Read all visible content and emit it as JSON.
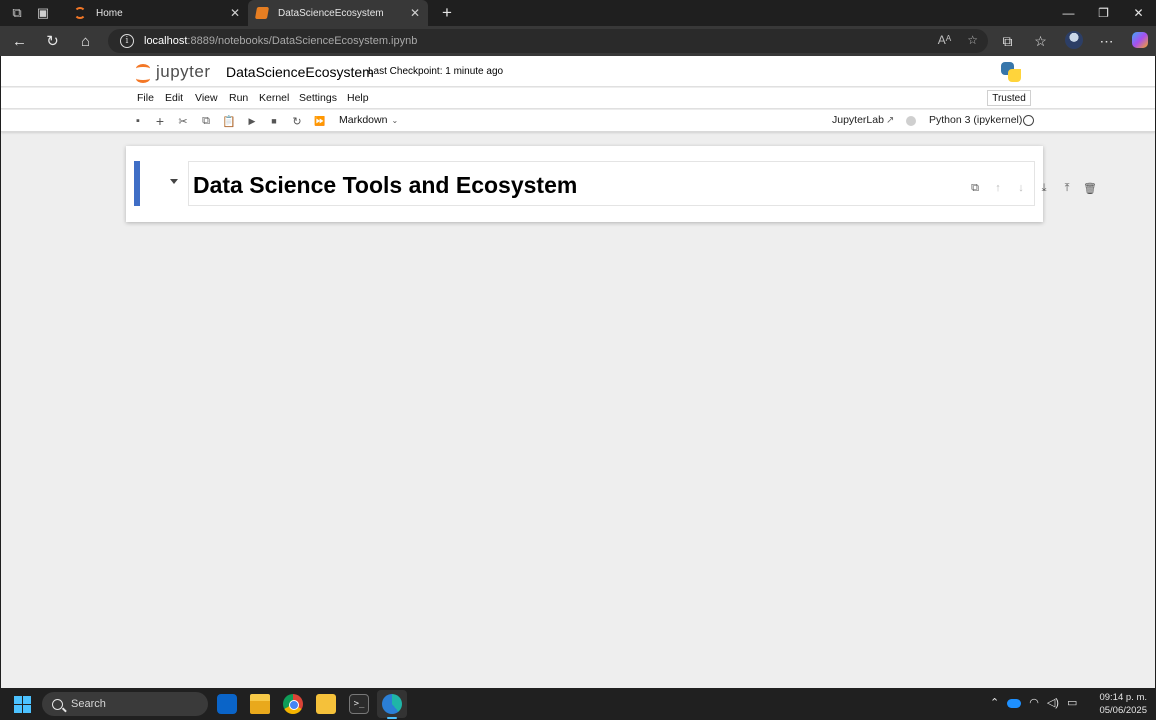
{
  "browser": {
    "tabs": [
      {
        "title": "Home",
        "close": "✕"
      },
      {
        "title": "DataScienceEcosystem",
        "close": "✕"
      }
    ],
    "new_tab": "+",
    "url_host": "localhost",
    "url_path": ":8889/notebooks/DataScienceEcosystem.ipynb",
    "window_controls": [
      "—",
      "❐",
      "✕"
    ]
  },
  "jupyter": {
    "logo_text": "jupyter",
    "notebook_title": "DataScienceEcosystem",
    "checkpoint": "Last Checkpoint: 1 minute ago",
    "menu": [
      "File",
      "Edit",
      "View",
      "Run",
      "Kernel",
      "Settings",
      "Help"
    ],
    "trusted": "Trusted",
    "cell_type": "Markdown",
    "jupyterlab_link": "JupyterLab",
    "kernel_name": "Python 3 (ipykernel)"
  },
  "notebook": {
    "cells": [
      {
        "type": "markdown",
        "rendered_heading": "Data Science Tools and Ecosystem"
      }
    ]
  },
  "taskbar": {
    "search_placeholder": "Search",
    "time": "09:14 p. m.",
    "date": "05/06/2025"
  },
  "colors": {
    "active_cell_bar": "#3f6ec6",
    "jupyter_orange": "#f37726",
    "windows_accent": "#4cc2ff"
  }
}
